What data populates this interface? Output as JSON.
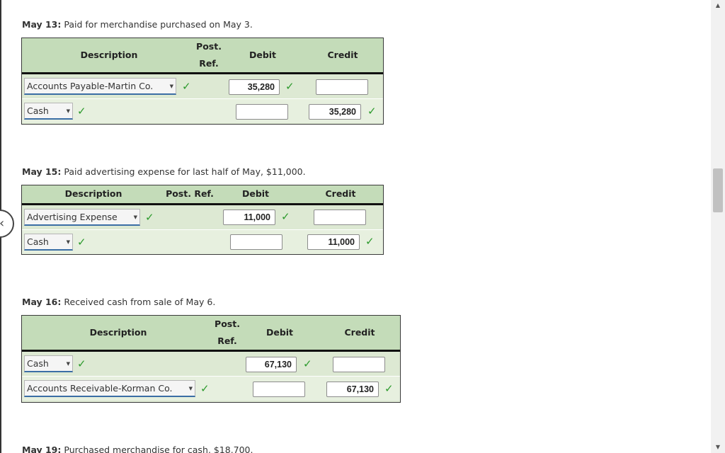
{
  "entries": [
    {
      "date": "May 13:",
      "text": "Paid for merchandise purchased on May 3.",
      "headers": {
        "description": "Description",
        "post_ref_line1": "Post.",
        "post_ref_line2": "Ref.",
        "debit": "Debit",
        "credit": "Credit"
      },
      "rows": [
        {
          "account": "Accounts Payable-Martin Co.",
          "debit": "35,280",
          "credit": ""
        },
        {
          "account": "Cash",
          "debit": "",
          "credit": "35,280"
        }
      ]
    },
    {
      "date": "May 15:",
      "text": "Paid advertising expense for last half of May, $11,000.",
      "headers": {
        "description": "Description",
        "post_ref": "Post. Ref.",
        "debit": "Debit",
        "credit": "Credit"
      },
      "rows": [
        {
          "account": "Advertising Expense",
          "debit": "11,000",
          "credit": ""
        },
        {
          "account": "Cash",
          "debit": "",
          "credit": "11,000"
        }
      ]
    },
    {
      "date": "May 16:",
      "text": "Received cash from sale of May 6.",
      "headers": {
        "description": "Description",
        "post_ref_line1": "Post.",
        "post_ref_line2": "Ref.",
        "debit": "Debit",
        "credit": "Credit"
      },
      "rows": [
        {
          "account": "Cash",
          "debit": "67,130",
          "credit": ""
        },
        {
          "account": "Accounts Receivable-Korman Co.",
          "debit": "",
          "credit": "67,130"
        }
      ]
    },
    {
      "date": "May 19:",
      "text": "Purchased merchandise for cash, $18,700."
    }
  ],
  "icons": {
    "check": "check-icon",
    "dropdown": "dropdown-arrow-icon",
    "nav": "chevron-left-icon"
  },
  "colors": {
    "header_bg": "#c4dcb9",
    "row_bg": "#dde9d3",
    "check": "#2c9a2c",
    "underline": "#3b6ea5"
  }
}
